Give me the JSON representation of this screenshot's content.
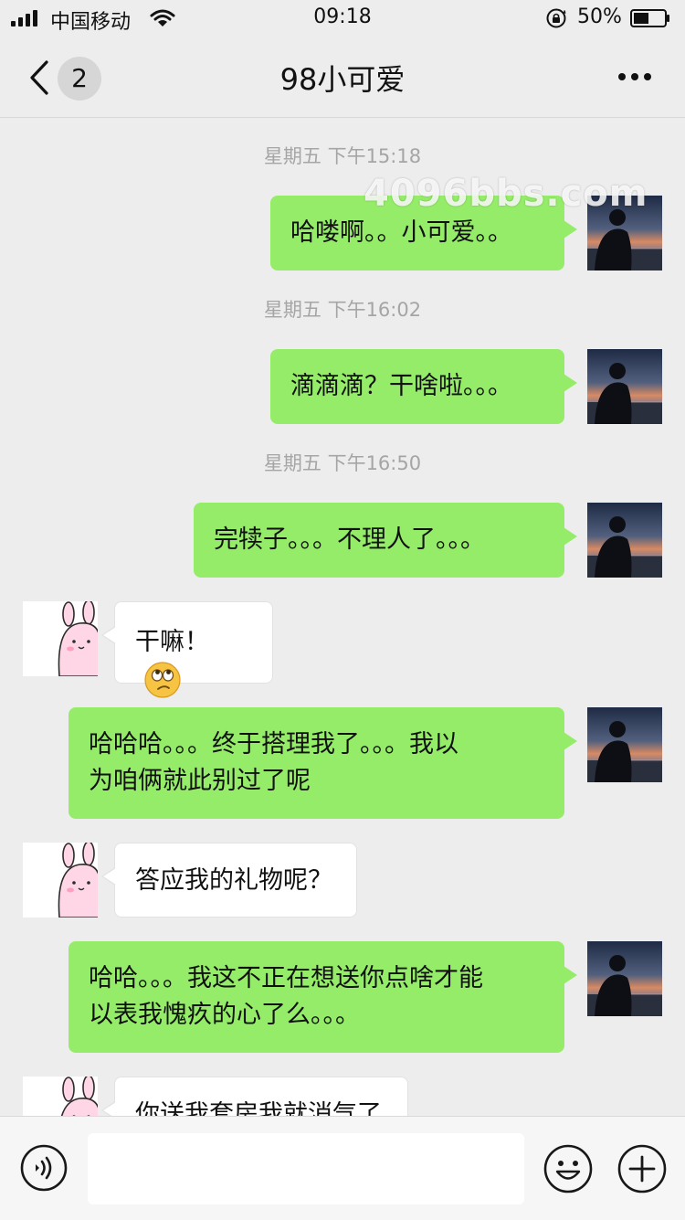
{
  "status_bar": {
    "carrier": "中国移动",
    "time": "09:18",
    "battery_percent": "50%",
    "battery_level": 0.5,
    "icons": [
      "signal-icon",
      "wifi-icon",
      "rotation-lock-icon",
      "battery-icon"
    ]
  },
  "header": {
    "title": "98小可爱",
    "unread_count": "2",
    "back_icon": "chevron-left-icon",
    "more_icon": "more-dots-icon"
  },
  "watermark": "4096bbs.com",
  "messages": [
    {
      "type": "timestamp",
      "text": "星期五 下午15:18"
    },
    {
      "type": "sent",
      "text": "哈喽啊。。小可爱。。"
    },
    {
      "type": "timestamp",
      "text": "星期五 下午16:02"
    },
    {
      "type": "sent",
      "text": "滴滴滴？干啥啦。。。"
    },
    {
      "type": "timestamp",
      "text": "星期五 下午16:50"
    },
    {
      "type": "sent",
      "text": "完犊子。。。不理人了。。。"
    },
    {
      "type": "received",
      "text": "干嘛！",
      "emoji": "rolling-eyes-emoji-icon"
    },
    {
      "type": "sent",
      "lines": [
        "哈哈哈。。。终于搭理我了。。。我以",
        "为咱俩就此别过了呢"
      ]
    },
    {
      "type": "received",
      "text": "答应我的礼物呢？"
    },
    {
      "type": "sent",
      "lines": [
        "哈哈。。。我这不正在想送你点啥才能",
        "以表我愧疚的心了么。。。"
      ]
    },
    {
      "type": "received",
      "text": "你送我套房我就消气了"
    }
  ],
  "input_bar": {
    "voice_icon": "voice-icon",
    "emoji_icon": "smiley-icon",
    "add_icon": "plus-circle-icon",
    "input_value": ""
  },
  "colors": {
    "background": "#ededed",
    "sent_bubble": "#95ec69",
    "received_bubble": "#ffffff",
    "timestamp_text": "#a5a5a5"
  }
}
